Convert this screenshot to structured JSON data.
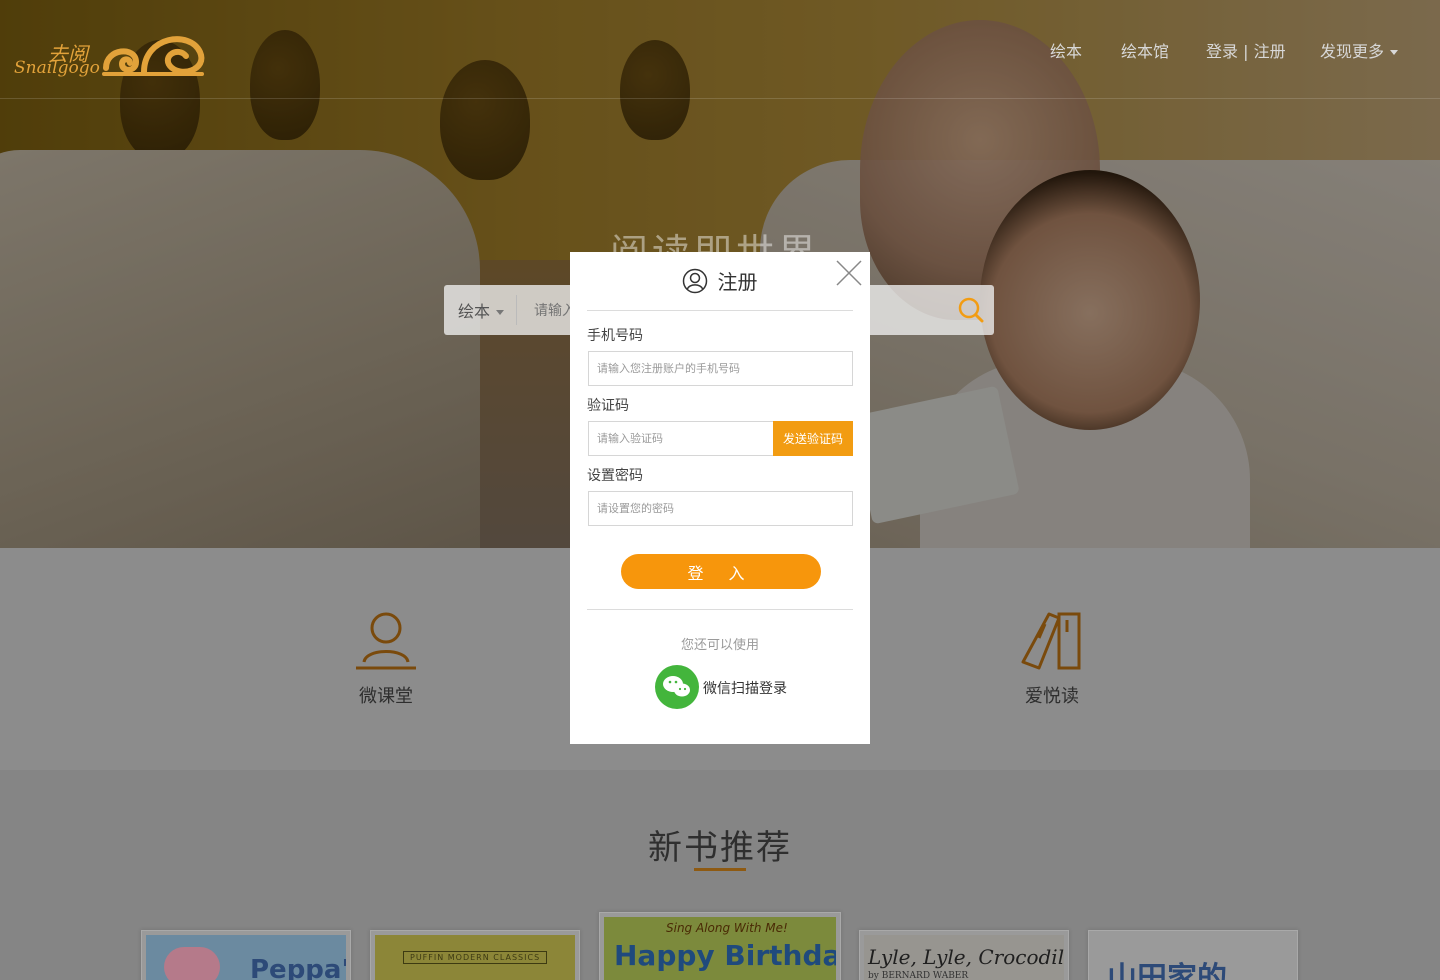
{
  "brand": {
    "name_cn": "去阅",
    "name_en": "Snailgogo"
  },
  "nav": {
    "items": [
      "绘本",
      "绘本馆",
      "登录 | 注册",
      "发现更多"
    ]
  },
  "hero": {
    "slogan": "阅读即世界",
    "search": {
      "category": "绘本",
      "placeholder": "请输入..."
    }
  },
  "features": [
    {
      "label": "微课堂",
      "icon": "teacher-icon"
    },
    {
      "label": "爱悦读",
      "icon": "books-icon"
    }
  ],
  "recommend": {
    "title": "新书推荐",
    "books": [
      {
        "cover_text": "Peppa's"
      },
      {
        "cover_text": "PUFFIN MODERN CLASSICS"
      },
      {
        "cover_top": "Sing Along With Me!",
        "cover_text": "Happy Birthday"
      },
      {
        "cover_text": "Lyle, Lyle, Crocodile",
        "cover_sub": "by BERNARD WABER"
      },
      {
        "cover_text": "山田家的"
      }
    ]
  },
  "modal": {
    "title": "注册",
    "phone_label": "手机号码",
    "phone_placeholder": "请输入您注册账户的手机号码",
    "code_label": "验证码",
    "code_placeholder": "请输入验证码",
    "send_code_label": "发送验证码",
    "password_label": "设置密码",
    "password_placeholder": "请设置您的密码",
    "submit_label": "登 入",
    "alt_text": "您还可以使用",
    "wechat_label": "微信扫描登录"
  },
  "colors": {
    "accent": "#f7960c",
    "wechat": "#43b53c",
    "logo": "#e2a23a"
  }
}
